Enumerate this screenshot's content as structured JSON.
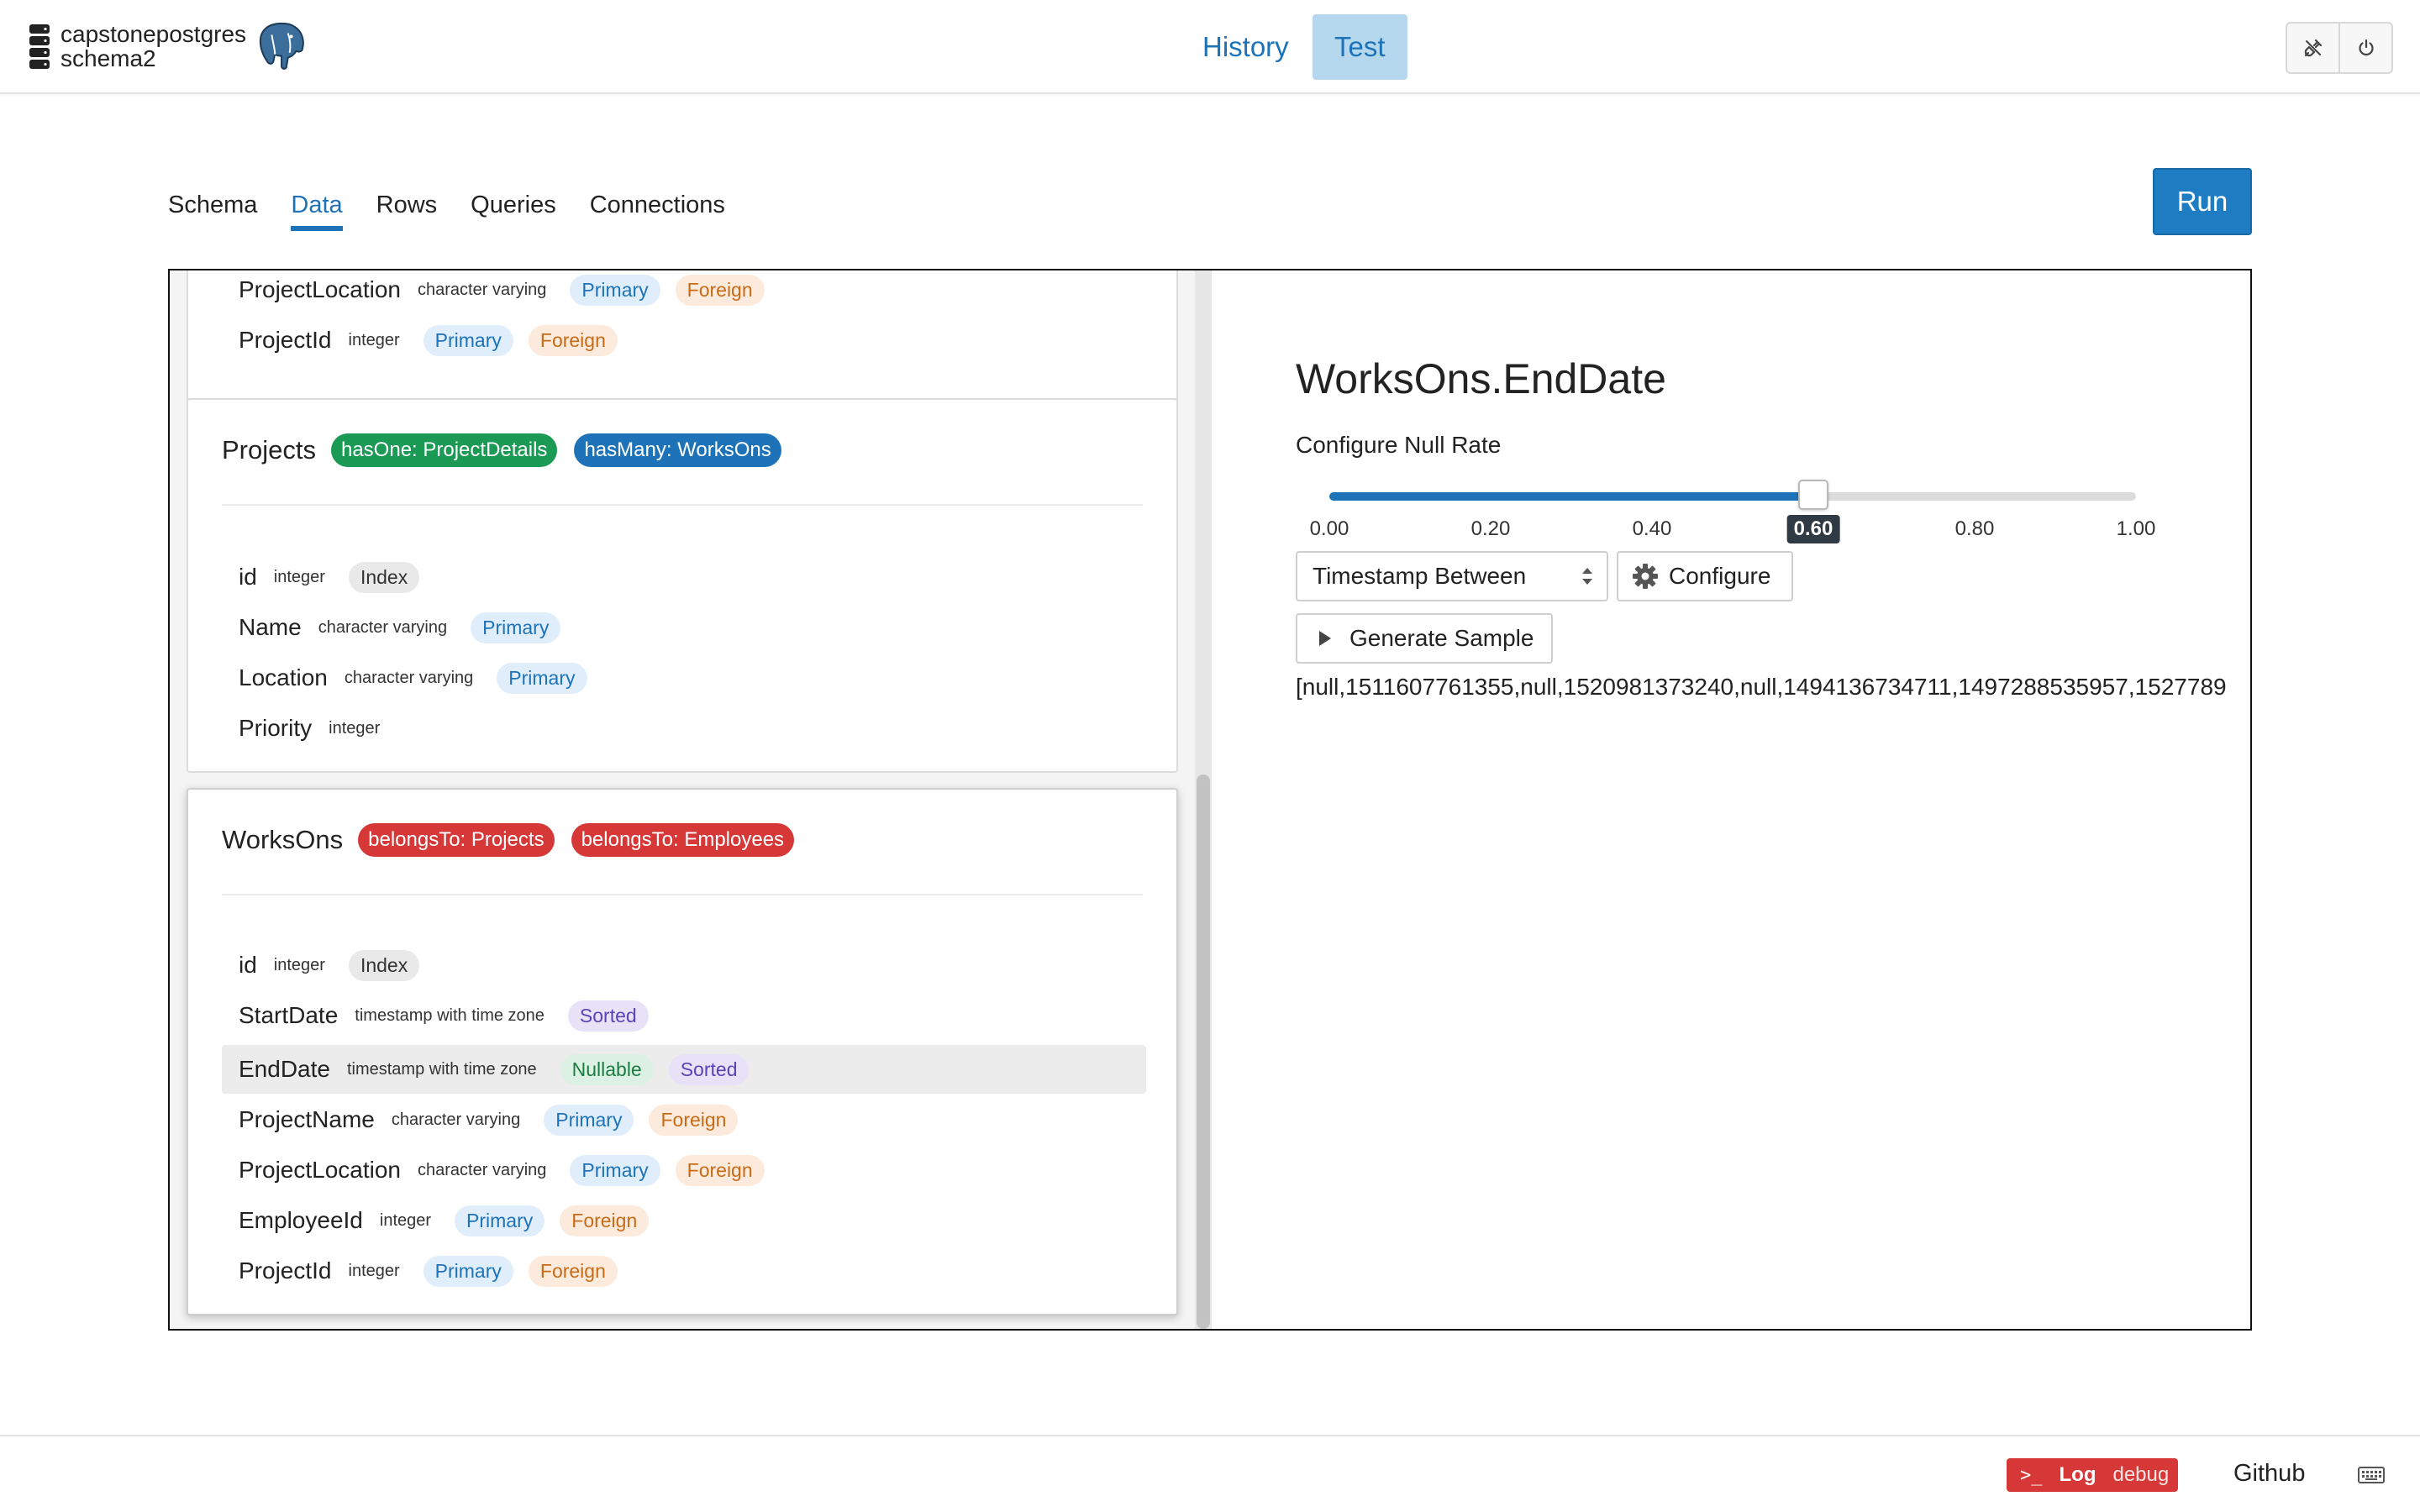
{
  "header": {
    "db_name": "capstonepostgres",
    "schema_name": "schema2",
    "nav": [
      {
        "label": "History",
        "active": false
      },
      {
        "label": "Test",
        "active": true
      }
    ],
    "icons": [
      "database-icon",
      "postgres-elephant-icon",
      "disconnect-plug-icon",
      "power-icon"
    ]
  },
  "subtabs": [
    {
      "label": "Schema",
      "active": false
    },
    {
      "label": "Data",
      "active": true
    },
    {
      "label": "Rows",
      "active": false
    },
    {
      "label": "Queries",
      "active": false
    },
    {
      "label": "Connections",
      "active": false
    }
  ],
  "run_label": "Run",
  "tables": [
    {
      "name": "",
      "relations": [],
      "columns": [
        {
          "name": "ProjectLocation",
          "type": "character varying",
          "tags": [
            "Primary",
            "Foreign"
          ],
          "highlighted": false
        },
        {
          "name": "ProjectId",
          "type": "integer",
          "tags": [
            "Primary",
            "Foreign"
          ],
          "highlighted": false
        }
      ]
    },
    {
      "name": "Projects",
      "relations": [
        {
          "label": "hasOne: ProjectDetails",
          "kind": "green"
        },
        {
          "label": "hasMany: WorksOns",
          "kind": "blue"
        }
      ],
      "columns": [
        {
          "name": "id",
          "type": "integer",
          "tags": [
            "Index"
          ],
          "highlighted": false
        },
        {
          "name": "Name",
          "type": "character varying",
          "tags": [
            "Primary"
          ],
          "highlighted": false
        },
        {
          "name": "Location",
          "type": "character varying",
          "tags": [
            "Primary"
          ],
          "highlighted": false
        },
        {
          "name": "Priority",
          "type": "integer",
          "tags": [],
          "highlighted": false
        }
      ]
    },
    {
      "name": "WorksOns",
      "relations": [
        {
          "label": "belongsTo: Projects",
          "kind": "red"
        },
        {
          "label": "belongsTo: Employees",
          "kind": "red"
        }
      ],
      "columns": [
        {
          "name": "id",
          "type": "integer",
          "tags": [
            "Index"
          ],
          "highlighted": false
        },
        {
          "name": "StartDate",
          "type": "timestamp with time zone",
          "tags": [
            "Sorted"
          ],
          "highlighted": false
        },
        {
          "name": "EndDate",
          "type": "timestamp with time zone",
          "tags": [
            "Nullable",
            "Sorted"
          ],
          "highlighted": true
        },
        {
          "name": "ProjectName",
          "type": "character varying",
          "tags": [
            "Primary",
            "Foreign"
          ],
          "highlighted": false
        },
        {
          "name": "ProjectLocation",
          "type": "character varying",
          "tags": [
            "Primary",
            "Foreign"
          ],
          "highlighted": false
        },
        {
          "name": "EmployeeId",
          "type": "integer",
          "tags": [
            "Primary",
            "Foreign"
          ],
          "highlighted": false
        },
        {
          "name": "ProjectId",
          "type": "integer",
          "tags": [
            "Primary",
            "Foreign"
          ],
          "highlighted": false
        }
      ]
    }
  ],
  "detail": {
    "field_title": "WorksOns.EndDate",
    "null_rate_label": "Configure Null Rate",
    "null_rate": 0.6,
    "null_rate_display": "0.60",
    "ticks": [
      "0.00",
      "0.20",
      "0.40",
      "0.60",
      "0.80",
      "1.00"
    ],
    "generator_selected": "Timestamp Between",
    "configure_label": "Configure",
    "generate_label": "Generate Sample",
    "sample_output": "[null,1511607761355,null,1520981373240,null,1494136734711,1497288535957,1527789"
  },
  "footer": {
    "log_label": "Log",
    "log_level": "debug",
    "github_label": "Github"
  },
  "colors": {
    "accent": "#1e73b8",
    "run_button": "#1e7cc2",
    "active_tab_bg": "#b6d8ee",
    "relation_green": "#1a9a55",
    "relation_red": "#d63838",
    "log_badge": "#d63838"
  }
}
